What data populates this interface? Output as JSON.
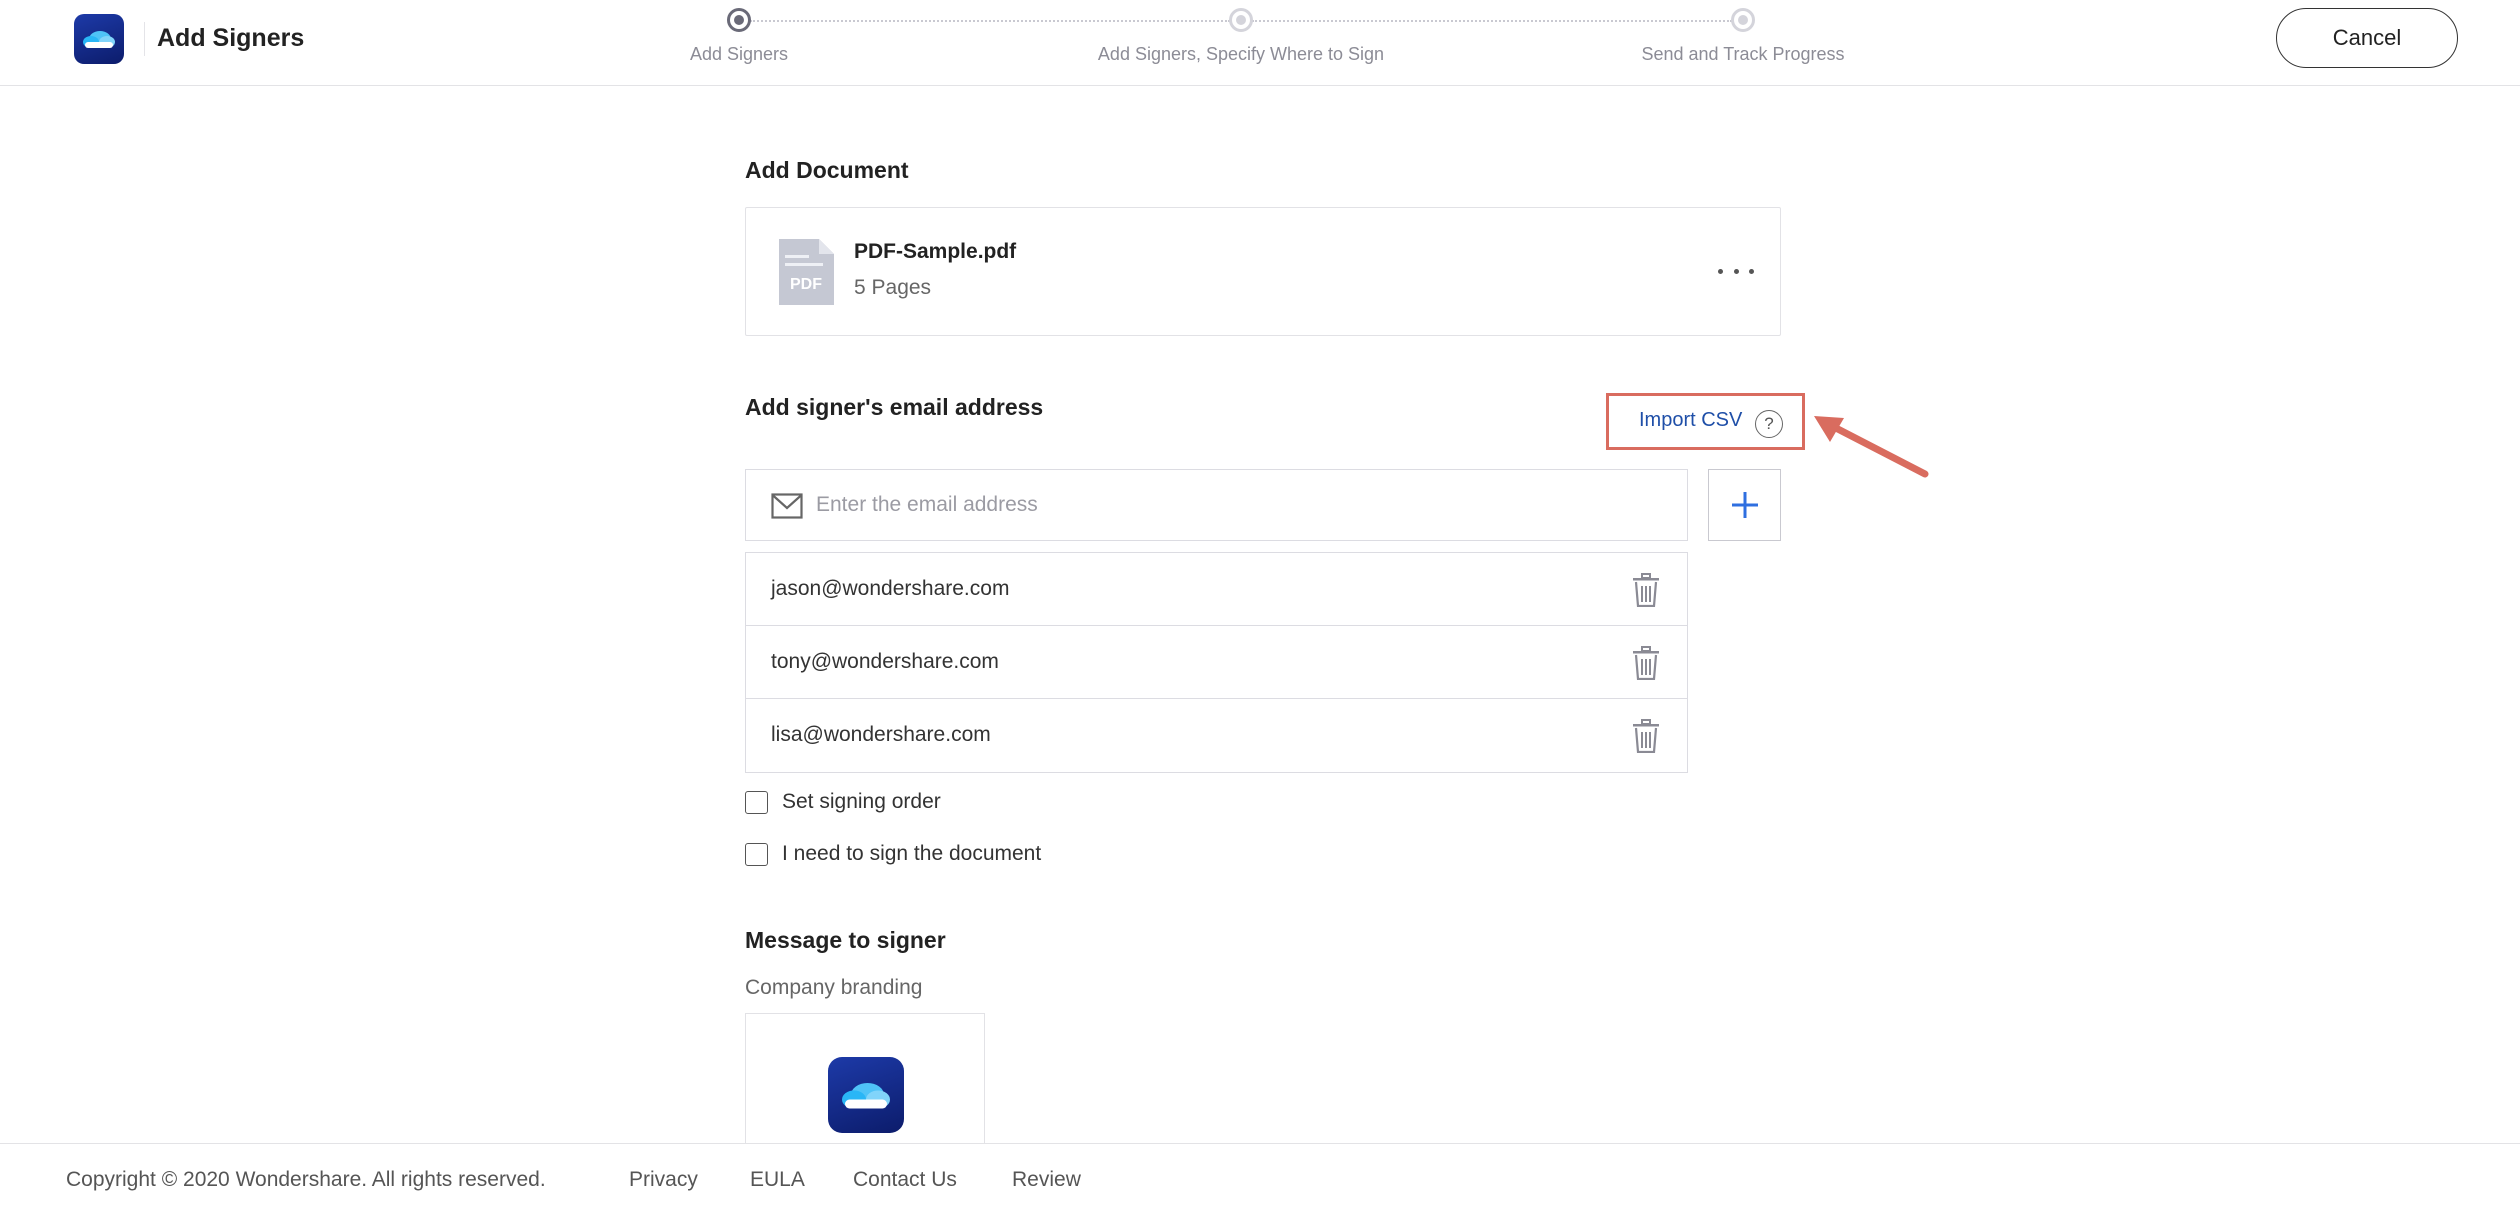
{
  "header": {
    "title": "Add Signers",
    "cancel_label": "Cancel"
  },
  "steps": [
    {
      "label": "Add Signers",
      "active": true
    },
    {
      "label": "Add Signers, Specify Where to Sign",
      "active": false
    },
    {
      "label": "Send and Track Progress",
      "active": false
    }
  ],
  "document_section": {
    "title": "Add Document",
    "file_name": "PDF-Sample.pdf",
    "pages": "5 Pages",
    "file_type_badge": "PDF"
  },
  "signers_section": {
    "title": "Add signer's email address",
    "import_csv_label": "Import CSV",
    "help_glyph": "?",
    "email_placeholder": "Enter the email address",
    "email_value": "",
    "emails": [
      "jason@wondershare.com",
      "tony@wondershare.com",
      "lisa@wondershare.com"
    ],
    "set_signing_order_label": "Set signing order",
    "set_signing_order_checked": false,
    "i_need_to_sign_label": "I need to sign the document",
    "i_need_to_sign_checked": false
  },
  "message_section": {
    "title": "Message to signer",
    "company_branding_label": "Company branding"
  },
  "footer": {
    "copyright": "Copyright © 2020 Wondershare. All rights reserved.",
    "links": [
      "Privacy",
      "EULA",
      "Contact Us",
      "Review"
    ]
  },
  "colors": {
    "brand_blue": "#1d3aa8",
    "link_blue": "#1f4fa8",
    "highlight_red": "#d96c5f",
    "add_plus_blue": "#2f6fe0"
  },
  "icons": {
    "logo": "cloud-logo-icon",
    "pdf": "pdf-file-icon",
    "more": "more-horizontal-icon",
    "help": "help-circle-icon",
    "mail": "mail-icon",
    "add": "plus-icon",
    "delete": "trash-icon",
    "annotation": "arrow-annotation-icon"
  }
}
